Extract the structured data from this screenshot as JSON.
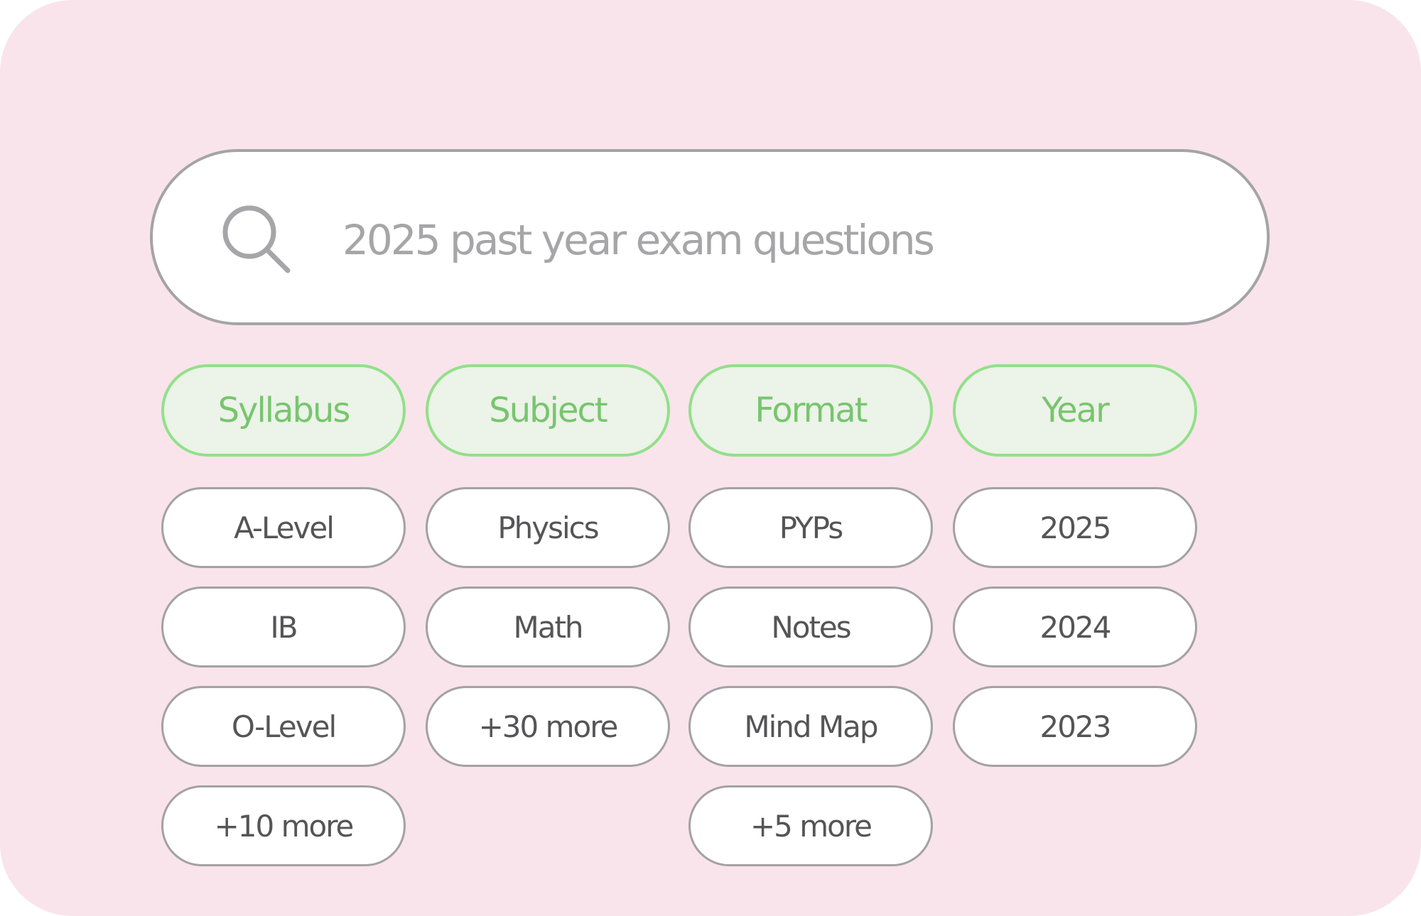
{
  "search": {
    "placeholder": "2025 past year exam questions",
    "icon": "search-icon"
  },
  "filters": {
    "syllabus": {
      "label": "Syllabus",
      "options": [
        "A-Level",
        "IB",
        "O-Level",
        "+10 more"
      ]
    },
    "subject": {
      "label": "Subject",
      "options": [
        "Physics",
        "Math",
        "+30 more"
      ]
    },
    "format": {
      "label": "Format",
      "options": [
        "PYPs",
        "Notes",
        "Mind Map",
        "+5 more"
      ]
    },
    "year": {
      "label": "Year",
      "options": [
        "2025",
        "2024",
        "2023"
      ]
    }
  },
  "colors": {
    "background": "#f9e4eb",
    "accent_green": "#78c56f",
    "accent_border": "#92e08a",
    "header_fill": "#ecf3e8",
    "text_dark": "#555557",
    "border_gray": "#a4a4a6"
  }
}
